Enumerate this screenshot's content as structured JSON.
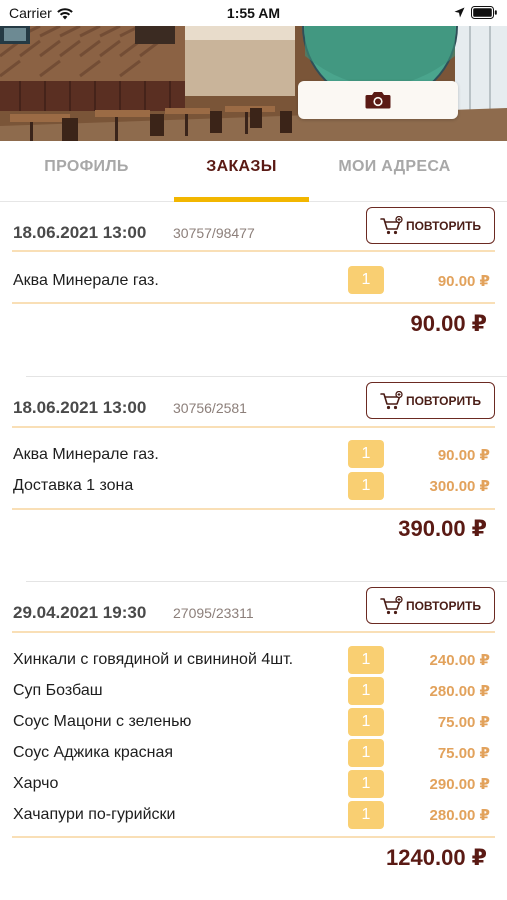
{
  "status": {
    "carrier": "Carrier",
    "time": "1:55 AM"
  },
  "tabs": [
    {
      "label": "ПРОФИЛЬ"
    },
    {
      "label": "ЗАКАЗЫ"
    },
    {
      "label": "МОИ АДРЕСА"
    }
  ],
  "active_tab": "ЗАКАЗЫ",
  "repeat_label": "ПОВТОРИТЬ",
  "currency": "₽",
  "orders": [
    {
      "date": "18.06.2021 13:00",
      "number": "30757/98477",
      "items": [
        {
          "name": "Аква Минерале газ.",
          "qty": "1",
          "price": "90.00 ₽"
        }
      ],
      "total": "90.00 ₽"
    },
    {
      "date": "18.06.2021 13:00",
      "number": "30756/2581",
      "items": [
        {
          "name": "Аква Минерале газ.",
          "qty": "1",
          "price": "90.00 ₽"
        },
        {
          "name": "Доставка 1 зона",
          "qty": "1",
          "price": "300.00 ₽"
        }
      ],
      "total": "390.00 ₽"
    },
    {
      "date": "29.04.2021 19:30",
      "number": "27095/23311",
      "items": [
        {
          "name": "Хинкали с говядиной и свининой 4шт.",
          "qty": "1",
          "price": "240.00 ₽"
        },
        {
          "name": "Суп Бозбаш",
          "qty": "1",
          "price": "280.00 ₽"
        },
        {
          "name": "Соус Мацони с зеленью",
          "qty": "1",
          "price": "75.00 ₽"
        },
        {
          "name": "Соус Аджика красная",
          "qty": "1",
          "price": "75.00 ₽"
        },
        {
          "name": "Харчо",
          "qty": "1",
          "price": "290.00 ₽"
        },
        {
          "name": "Хачапури по-гурийски",
          "qty": "1",
          "price": "280.00 ₽"
        }
      ],
      "total": "1240.00 ₽"
    }
  ],
  "colors": {
    "accent": "#f2b600",
    "brand_dark": "#5a1a14",
    "qty_badge": "#f9cf72",
    "price": "#e2a25c",
    "separator": "#f9dfb6"
  },
  "icons": {
    "camera": "camera-icon",
    "cart": "cart-icon",
    "wifi": "wifi-icon",
    "location": "location-arrow-icon",
    "battery": "battery-icon"
  }
}
